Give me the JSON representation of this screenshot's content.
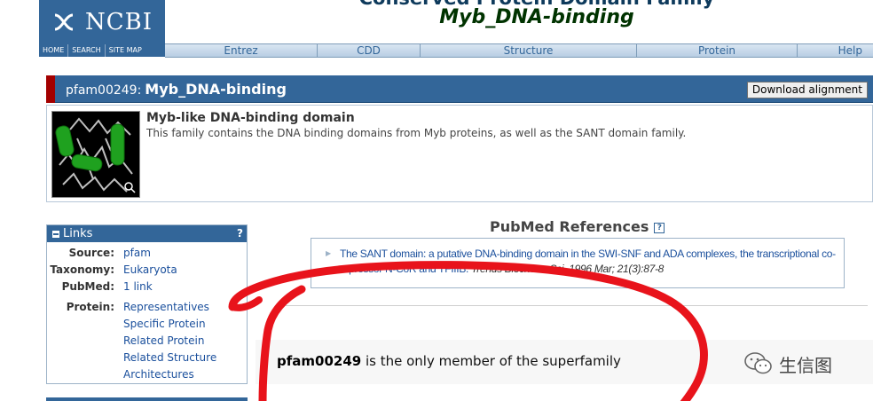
{
  "header": {
    "logo_text": "NCBI",
    "title_top": "Conserved Protein Domain Family",
    "title_main": "Myb_DNA-binding",
    "util_links": [
      "HOME",
      "SEARCH",
      "SITE MAP"
    ],
    "nav_items": [
      "Entrez",
      "CDD",
      "Structure",
      "Protein",
      "Help"
    ]
  },
  "titlebar": {
    "accession": "pfam00249:",
    "short_name": "Myb_DNA-binding",
    "download_label": "Download alignment"
  },
  "summary": {
    "title": "Myb-like DNA-binding domain",
    "description": "This family contains the DNA binding domains from Myb proteins, as well as the SANT domain family."
  },
  "links": {
    "header": "Links",
    "help": "?",
    "rows": [
      {
        "key": "Source:",
        "value": "pfam"
      },
      {
        "key": "Taxonomy:",
        "value": "Eukaryota"
      },
      {
        "key": "PubMed:",
        "value": "1 link"
      },
      {
        "key": "Protein:",
        "value": "Representatives"
      }
    ],
    "protein_more": [
      "Specific Protein",
      "Related Protein",
      "Related Structure",
      "Architectures"
    ]
  },
  "pubmed": {
    "title": "PubMed References",
    "help": "?",
    "ref_link": "The SANT domain: a putative DNA-binding domain in the SWI-SNF and ADA complexes, the transcriptional co-repressor N-CoR and TFIIIB.",
    "ref_citation": "Trends Biochem. Sci. 1996 Mar; 21(3):87-8"
  },
  "superfamily": {
    "accession": "pfam00249",
    "text": " is the only member of the superfamily"
  },
  "watermark": {
    "text": "生信图"
  },
  "colors": {
    "ncbi_blue": "#336699",
    "title_red": "#a30000",
    "link_blue": "#1a4f9c",
    "annotation_red": "#e8131b"
  },
  "icons": [
    "dna-helix-logo-icon",
    "minus-collapse-icon",
    "help-icon",
    "bullet-icon",
    "magnify-icon",
    "wechat-icon"
  ]
}
